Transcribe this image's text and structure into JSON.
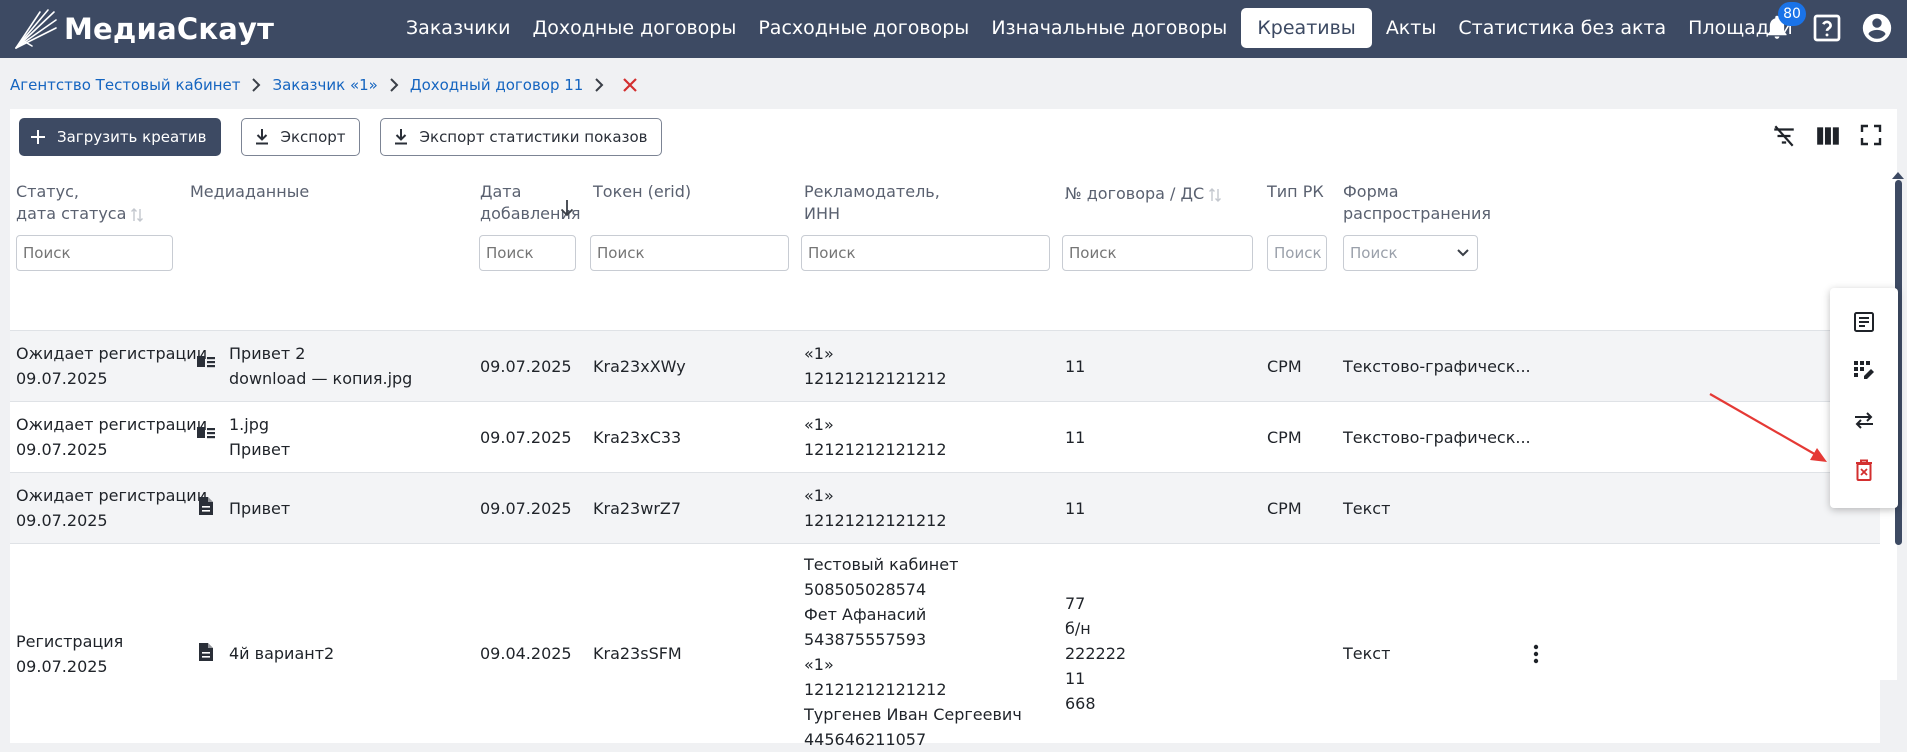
{
  "header": {
    "logo_text": "МедиаСкаут",
    "nav": [
      {
        "label": "Заказчики",
        "active": false
      },
      {
        "label": "Доходные договоры",
        "active": false
      },
      {
        "label": "Расходные договоры",
        "active": false
      },
      {
        "label": "Изначальные договоры",
        "active": false
      },
      {
        "label": "Креативы",
        "active": true
      },
      {
        "label": "Акты",
        "active": false
      },
      {
        "label": "Статистика без акта",
        "active": false
      },
      {
        "label": "Площадки",
        "active": false
      }
    ],
    "notifications_count": "80"
  },
  "breadcrumb": {
    "items": [
      "Агентство Тестовый кабинет",
      "Заказчик «1»",
      "Доходный договор 11"
    ]
  },
  "toolbar": {
    "upload_label": "Загрузить креатив",
    "export_label": "Экспорт",
    "export_stats_label": "Экспорт статистики показов"
  },
  "table": {
    "columns": {
      "status": [
        "Статус,",
        "дата статуса"
      ],
      "media": [
        "Медиаданные"
      ],
      "date_added": [
        "Дата",
        "добавления"
      ],
      "token": [
        "Токен (erid)"
      ],
      "advertiser": [
        "Рекламодатель,",
        "ИНН"
      ],
      "contract": [
        "№ договора / ДС"
      ],
      "type": [
        "Тип РК"
      ],
      "form": [
        "Форма",
        "распространения"
      ]
    },
    "search_placeholder": "Поиск",
    "rows": [
      {
        "status": "Ожидает регистрации",
        "status_date": "09.07.2025",
        "media_icon": "image-text-icon",
        "media": [
          "Привет 2",
          "download — копия.jpg"
        ],
        "date_added": "09.07.2025",
        "token": "Kra23xXWy",
        "advertiser": [
          "«1»",
          "12121212121212"
        ],
        "contract": [
          "11"
        ],
        "type": "CPM",
        "form": "Текстово-графическ..."
      },
      {
        "status": "Ожидает регистрации",
        "status_date": "09.07.2025",
        "media_icon": "image-text-icon",
        "media": [
          "1.jpg",
          "Привет"
        ],
        "date_added": "09.07.2025",
        "token": "Kra23xC33",
        "advertiser": [
          "«1»",
          "12121212121212"
        ],
        "contract": [
          "11"
        ],
        "type": "CPM",
        "form": "Текстово-графическ..."
      },
      {
        "status": "Ожидает регистрации",
        "status_date": "09.07.2025",
        "media_icon": "document-icon",
        "media": [
          "Привет"
        ],
        "date_added": "09.07.2025",
        "token": "Kra23wrZ7",
        "advertiser": [
          "«1»",
          "12121212121212"
        ],
        "contract": [
          "11"
        ],
        "type": "CPM",
        "form": "Текст"
      },
      {
        "status": "Регистрация",
        "status_date": "09.07.2025",
        "media_icon": "document-icon",
        "media": [
          "4й вариант2"
        ],
        "date_added": "09.04.2025",
        "token": "Kra23sSFM",
        "advertiser": [
          "Тестовый кабинет",
          "508505028574",
          "Фет Афанасий",
          "543875557593",
          "«1»",
          "12121212121212",
          "Тургенев Иван Сергеевич",
          "445646211057"
        ],
        "contract": [
          "77",
          "б/н",
          "222222",
          "11",
          "668"
        ],
        "type": "",
        "form": "Текст"
      }
    ]
  },
  "colors": {
    "header_bg": "#3d4a63",
    "link": "#1565c0",
    "danger": "#d32f2f",
    "badge": "#1a73e8"
  }
}
